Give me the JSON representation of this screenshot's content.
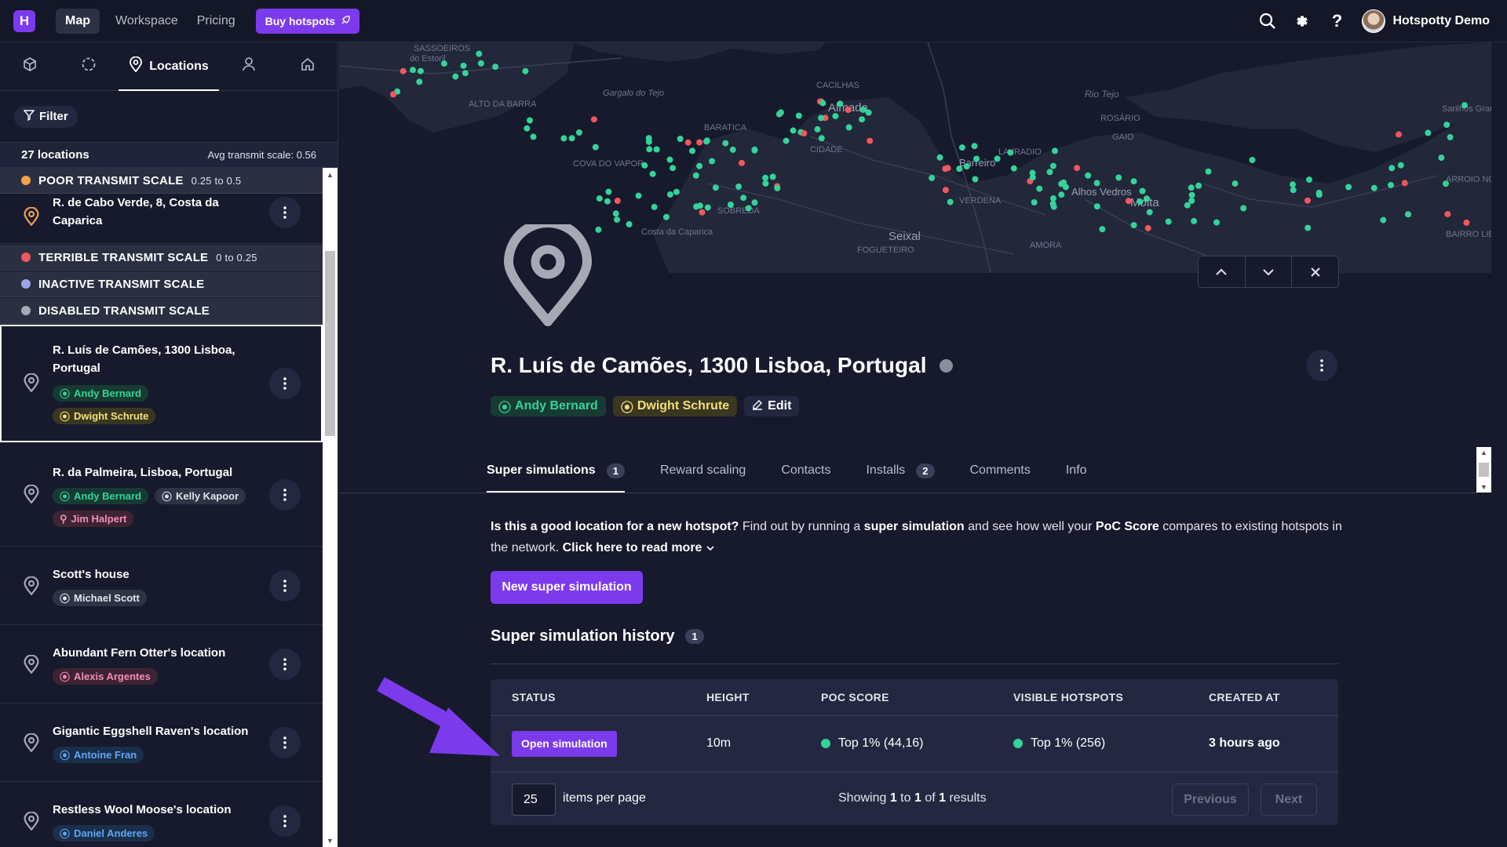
{
  "nav": {
    "logo": "H",
    "links": [
      "Map",
      "Workspace",
      "Pricing"
    ],
    "buy_label": "Buy hotspots",
    "user_name": "Hotspotty Demo"
  },
  "left": {
    "tab_active": "Locations",
    "filter_label": "Filter",
    "count": "27 locations",
    "avg": "Avg transmit scale: 0.56",
    "groups": [
      {
        "label": "POOR TRANSMIT SCALE",
        "range": "0.25 to 0.5",
        "color": "#f4a04a"
      },
      {
        "label": "TERRIBLE TRANSMIT SCALE",
        "range": "0 to 0.25",
        "color": "#f2575e"
      },
      {
        "label": "INACTIVE TRANSMIT SCALE",
        "range": "",
        "color": "#9aa4e8"
      },
      {
        "label": "DISABLED TRANSMIT SCALE",
        "range": "",
        "color": "#a6a9b5"
      }
    ],
    "locations": [
      {
        "title": "R. de Cabo Verde, 8, Costa da Caparica",
        "chips": []
      },
      {
        "title": "R. Luís de Camões, 1300 Lisboa, Portugal",
        "chips": [
          "Andy Bernard",
          "Dwight Schrute"
        ]
      },
      {
        "title": "R. da Palmeira, Lisboa, Portugal",
        "chips": [
          "Andy Bernard",
          "Kelly Kapoor",
          "Jim Halpert"
        ]
      },
      {
        "title": "Scott's house",
        "chips": [
          "Michael Scott"
        ]
      },
      {
        "title": "Abundant Fern Otter's location",
        "chips": [
          "Alexis Argentes"
        ]
      },
      {
        "title": "Gigantic Eggshell Raven's location",
        "chips": [
          "Antoine Fran"
        ]
      },
      {
        "title": "Restless Wool Moose's location",
        "chips": [
          "Daniel Anderes"
        ]
      }
    ]
  },
  "map": {
    "labels": [
      "SASSOEIROS",
      "do Estoril",
      "ALTO DA BARRA",
      "Gargalo do Tejo",
      "CACILHAS",
      "Almada",
      "BARATICA",
      "CIDADE",
      "COVA DO VAPOR",
      "SOBREDA",
      "Costa da Caparica",
      "Seixal",
      "Barreiro",
      "LAVRADIO",
      "VERDENA",
      "Alhos Vedros",
      "Moita",
      "Rio Tejo",
      "ROSÁRIO",
      "GAIO",
      "Sarilhos Grandes",
      "ARROIO NOVO",
      "BAIRRO LIBERDADE",
      "FOGUETEIRO",
      "AMORA"
    ]
  },
  "detail": {
    "title": "R. Luís de Camões, 1300 Lisboa, Portugal",
    "chips": [
      "Andy Bernard",
      "Dwight Schrute"
    ],
    "edit_label": "Edit",
    "tabs": [
      {
        "label": "Super simulations",
        "badge": "1"
      },
      {
        "label": "Reward scaling",
        "badge": ""
      },
      {
        "label": "Contacts",
        "badge": ""
      },
      {
        "label": "Installs",
        "badge": "2"
      },
      {
        "label": "Comments",
        "badge": ""
      },
      {
        "label": "Info",
        "badge": ""
      }
    ],
    "intro_q": "Is this a good location for a new hotspot?",
    "intro_1": " Find out by running a ",
    "intro_b1": "super simulation",
    "intro_2": " and see how well your ",
    "intro_b2": "PoC Score",
    "intro_3": " compares to existing hotspots in the network. ",
    "intro_link": "Click here to read more",
    "new_btn": "New super simulation",
    "history_title": "Super simulation history",
    "history_badge": "1",
    "table": {
      "headers": [
        "STATUS",
        "HEIGHT",
        "POC SCORE",
        "VISIBLE HOTSPOTS",
        "CREATED AT"
      ],
      "row": {
        "status_btn": "Open simulation",
        "height": "10m",
        "poc": "Top 1% (44,16)",
        "visible": "Top 1% (256)",
        "created": "3 hours ago"
      },
      "per_page": "25",
      "per_page_label": "items per page",
      "showing_1": "Showing ",
      "showing_from": "1",
      "showing_2": " to ",
      "showing_to": "1",
      "showing_3": " of ",
      "showing_total": "1",
      "showing_4": " results",
      "prev": "Previous",
      "next": "Next"
    }
  },
  "colors": {
    "accent": "#7c3aed",
    "green": "#34d399",
    "red": "#f2575e",
    "bg": "#161a2c"
  }
}
